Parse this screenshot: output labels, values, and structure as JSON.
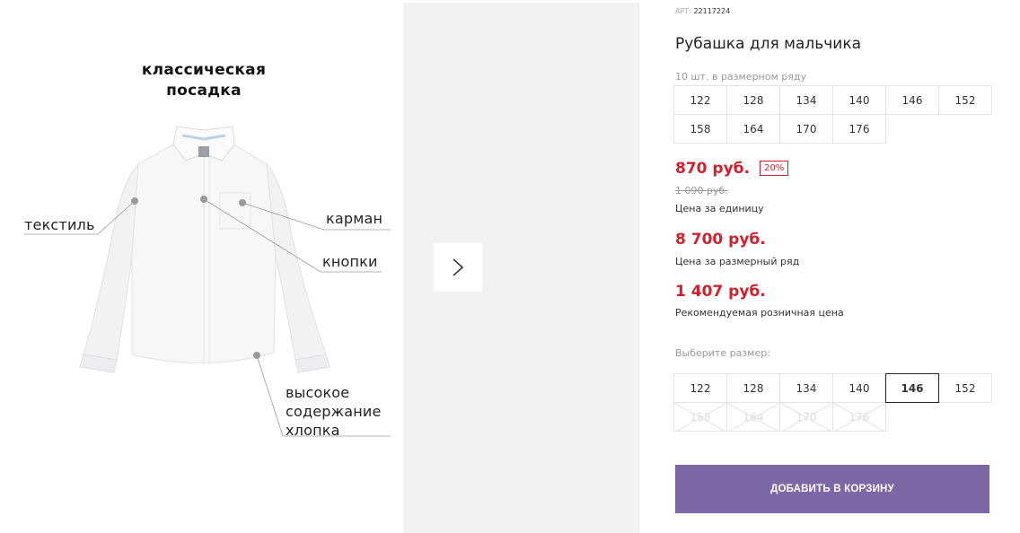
{
  "gallery": {
    "headline_line1": "классическая",
    "headline_line2": "посадка",
    "callouts": {
      "textile": "текстиль",
      "pocket": "карман",
      "buttons": "кнопки",
      "cotton_line1": "высокое",
      "cotton_line2": "содержание",
      "cotton_line3": "хлопка"
    },
    "next_icon": "chevron-right-icon"
  },
  "product": {
    "art_label": "АРТ:",
    "art_value": "22117224",
    "title": "Рубашка для мальчика",
    "pack_note": "10 шт. в размерном ряду",
    "pack_sizes": [
      "122",
      "128",
      "134",
      "140",
      "146",
      "152",
      "158",
      "164",
      "170",
      "176"
    ],
    "price": "870 руб.",
    "discount": "20%",
    "old_price": "1 090 руб.",
    "price_unit_label": "Цена за единицу",
    "pack_price": "8 700 руб.",
    "pack_price_label": "Цена за размерный ряд",
    "rrp": "1 407 руб.",
    "rrp_label": "Рекомендуемая розничная цена",
    "choose_size_label": "Выберите размер:",
    "selectable_sizes": [
      "122",
      "128",
      "134",
      "140",
      "146",
      "152"
    ],
    "selected_size": "146",
    "unavailable_sizes": [
      "158",
      "164",
      "170",
      "176"
    ],
    "add_to_cart": "ДОБАВИТЬ В КОРЗИНУ"
  },
  "colors": {
    "accent_price": "#d4202d",
    "cart_button": "#7e67a5"
  }
}
